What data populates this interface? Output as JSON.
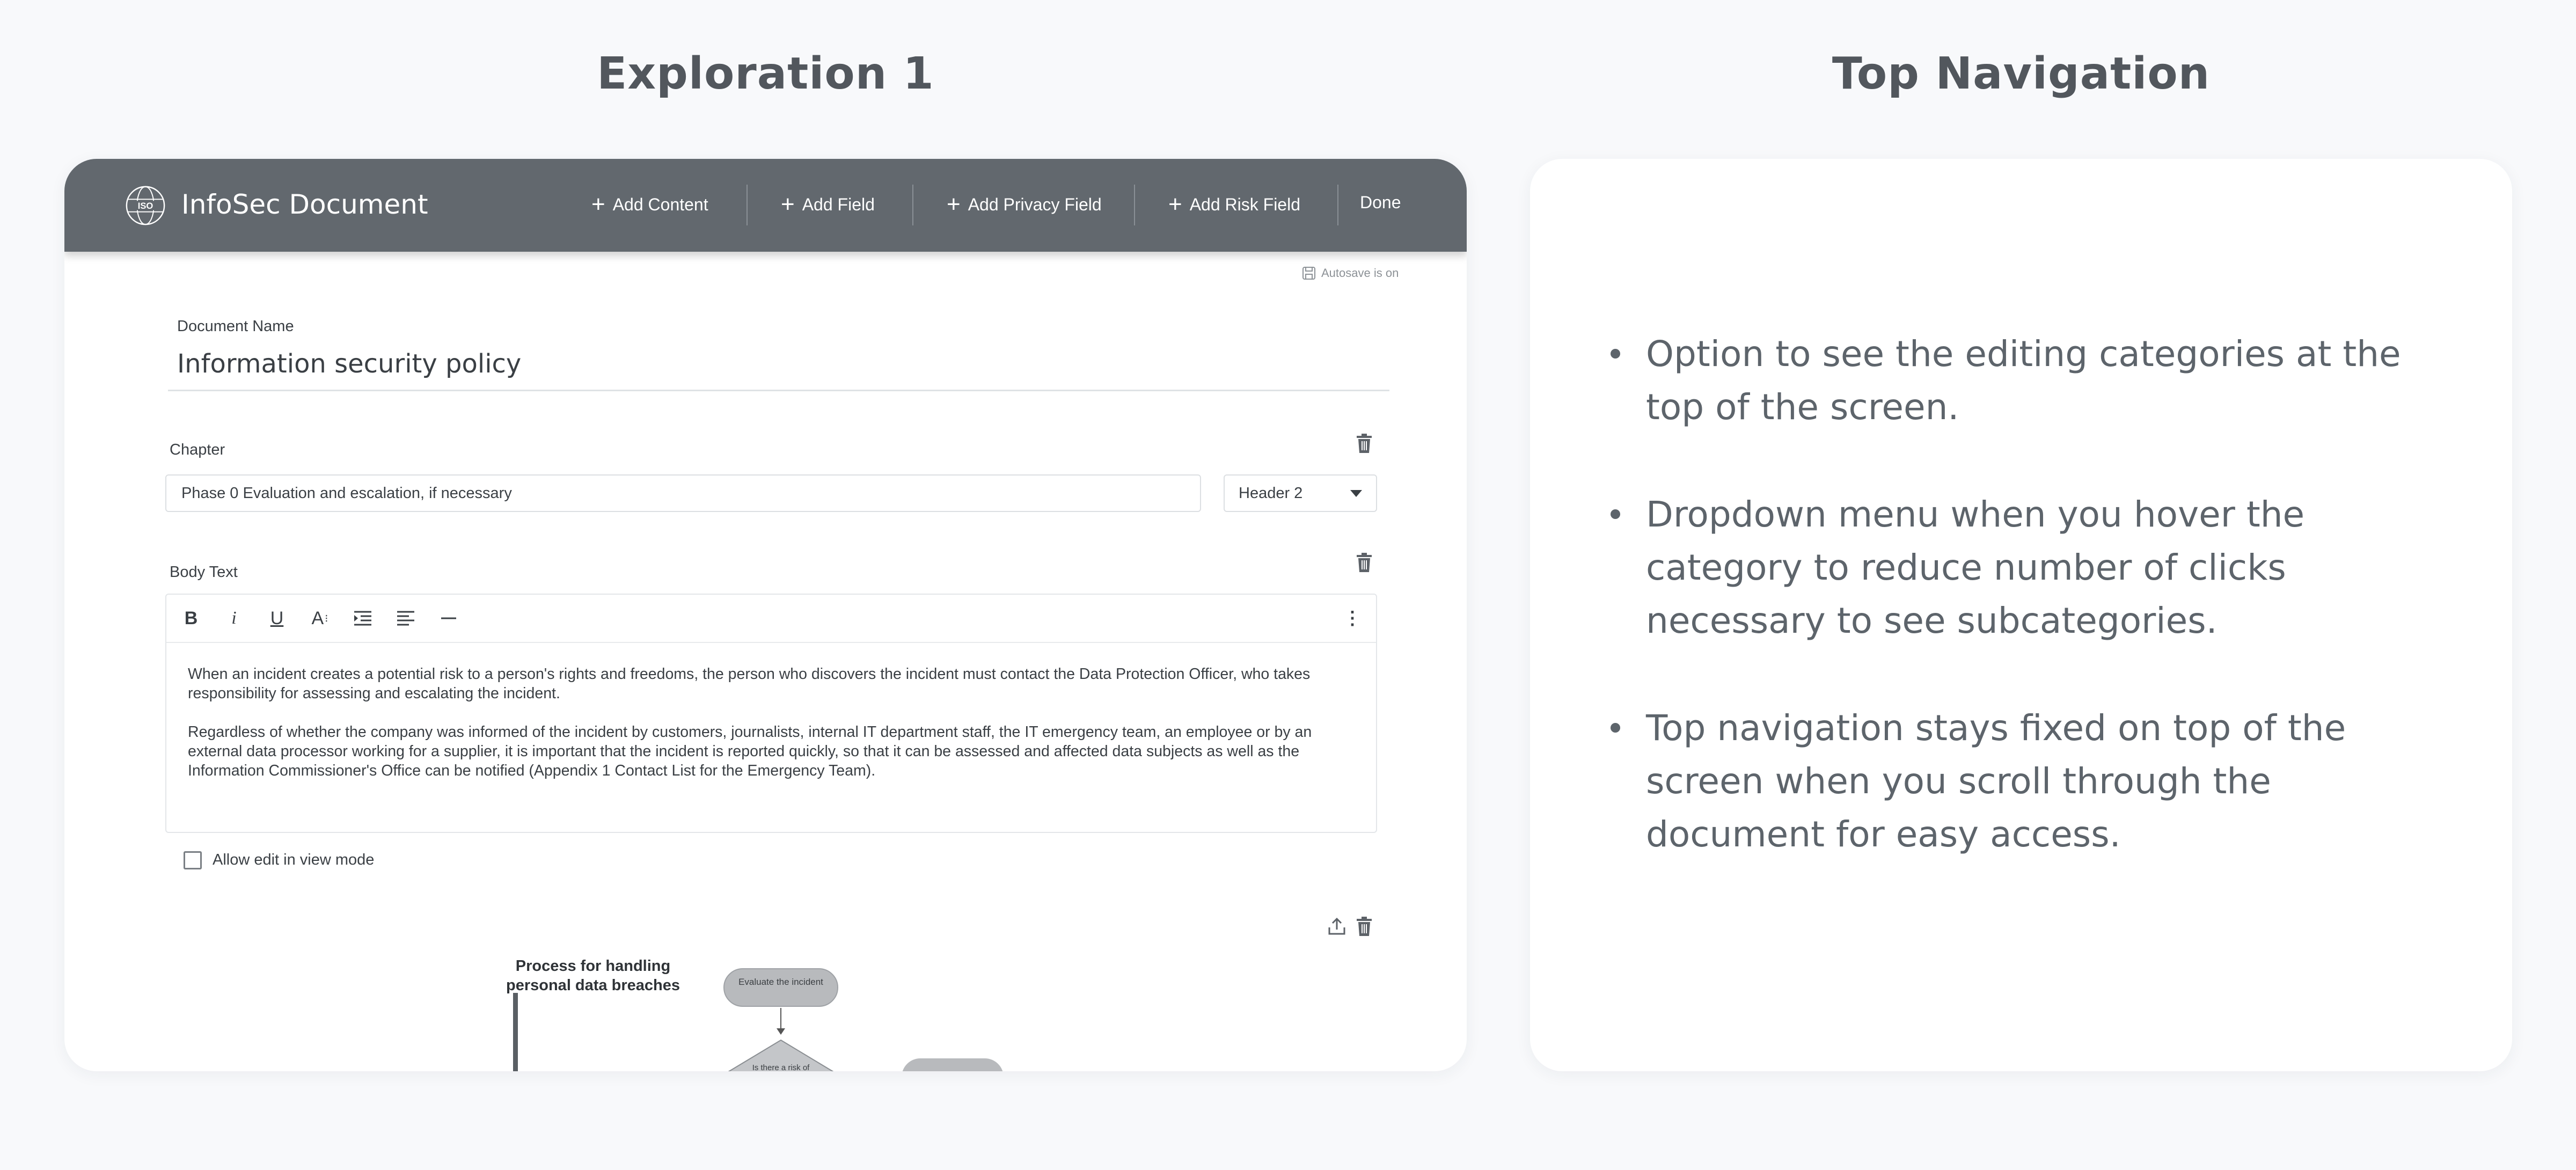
{
  "headings": {
    "left": "Exploration 1",
    "right": "Top Navigation"
  },
  "app": {
    "title": "InfoSec Document",
    "logo_text": "ISO"
  },
  "nav": {
    "add_content": "Add Content",
    "add_field": "Add Field",
    "add_privacy_field": "Add Privacy Field",
    "add_risk_field": "Add Risk Field",
    "done": "Done"
  },
  "autosave": "Autosave is on",
  "document": {
    "name_label": "Document Name",
    "name_value": "Information security policy"
  },
  "chapter": {
    "label": "Chapter",
    "value": "Phase 0 Evaluation and escalation, if necessary",
    "style_selected": "Header 2"
  },
  "body": {
    "label": "Body Text",
    "paragraphs": [
      "When an incident creates a potential risk to a person's rights and freedoms, the person who discovers the incident must contact the Data Protection Officer, who takes responsibility for assessing and escalating the incident.",
      "Regardless of whether the company was informed of the incident by customers, journalists, internal IT department staff, the IT emergency team, an employee or by an external data processor working for a supplier, it is important that the incident is reported quickly, so that it can be assessed and affected data subjects as well as the Information Commissioner's Office can be notified (Appendix 1 Contact List for the Emergency Team)."
    ],
    "toolbar": {
      "bold": "B",
      "italic": "i",
      "underline": "U",
      "font_size": "A",
      "more": "⋮"
    }
  },
  "allow_edit": {
    "label": "Allow edit in view mode",
    "checked": false
  },
  "flowchart": {
    "title_line1": "Process for handling",
    "title_line2": "personal data breaches",
    "node1": "Evaluate the incident",
    "node2": "Is there a risk of"
  },
  "notes": [
    "Option to see the editing categories at the top of the screen.",
    "Dropdown menu when you hover the category to reduce number of clicks necessary to see subcategories.",
    "Top navigation stays fixed on top of the screen when you scroll through the document for easy access."
  ],
  "colors": {
    "topbar": "#62686e",
    "page_bg": "#f8f9fb",
    "card_bg": "#ffffff",
    "text_dark": "#3a3f44",
    "bullet_text": "#5d646b"
  }
}
